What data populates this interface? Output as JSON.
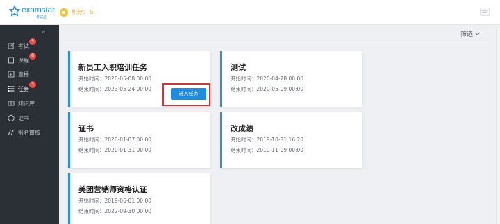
{
  "header": {
    "logo_text": "examstar",
    "logo_subtitle": "考试星",
    "points_text": "积分： 5"
  },
  "sidebar": {
    "collapse_glyph": "«",
    "items": [
      {
        "label": "考试",
        "icon": "edit-icon",
        "badge": "5",
        "active": false
      },
      {
        "label": "课程",
        "icon": "book-icon",
        "badge": "8",
        "active": false
      },
      {
        "label": "直播",
        "icon": "live-icon",
        "badge": "",
        "active": false
      },
      {
        "label": "任务",
        "icon": "list-icon",
        "badge": "3",
        "active": true
      },
      {
        "label": "知识库",
        "icon": "library-icon",
        "badge": "",
        "active": false
      },
      {
        "label": "证书",
        "icon": "certificate-icon",
        "badge": "",
        "active": false
      },
      {
        "label": "报名审核",
        "icon": "audit-icon",
        "badge": "",
        "active": false
      }
    ]
  },
  "toolbar": {
    "filter_label": "筛选"
  },
  "tasks": [
    {
      "title": "新员工入职培训任务",
      "start": "开始时间：2020-05-08 00:00",
      "end": "结束时间：2023-05-24 00:00"
    },
    {
      "title": "测试",
      "start": "开始时间：2020-04-28 00:00",
      "end": "结束时间：2020-05-09 00:00"
    },
    {
      "title": "证书",
      "start": "开始时间：2020-01-07 00:00",
      "end": "结束时间：2020-01-31 00:00"
    },
    {
      "title": "改成绩",
      "start": "开始时间：2019-10-31 16:20",
      "end": "结束时间：2019-11-09 00:00"
    },
    {
      "title": "美团营销师资格认证",
      "start": "开始时间：2019-06-01 00:00",
      "end": "结束时间：2022-09-30 00:00"
    }
  ],
  "enter_button_label": "进入任务",
  "colors": {
    "accent": "#2d8cf0",
    "sidebar_bg": "#2b2f36",
    "badge": "#f04a4a",
    "highlight": "#d93030",
    "points": "#f0a72b"
  }
}
